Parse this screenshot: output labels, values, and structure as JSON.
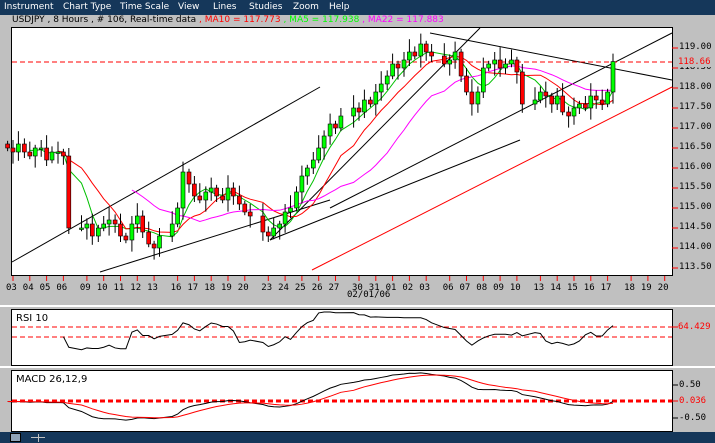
{
  "menu": [
    "Instrument",
    "Chart Type",
    "Time Scale",
    "View",
    "Lines",
    "Studies",
    "Zoom",
    "Help"
  ],
  "title": {
    "info": "USDJPY , 8 Hours , # 106, Real-time data",
    "ma10": " , MA10 = 117.773",
    "ma5": " , MA5 = 117.938",
    "ma22": " , MA22 = 117.883"
  },
  "colors": {
    "up": "#00ff00",
    "down": "#ff0000",
    "ma5": "#00c000",
    "ma10": "#ff0000",
    "ma22": "#ff00ff",
    "menubar": "#15375a"
  },
  "price_axis": [
    "119.00",
    "118.50",
    "118.00",
    "117.50",
    "117.00",
    "116.50",
    "116.00",
    "115.50",
    "115.00",
    "114.50",
    "114.00",
    "113.50"
  ],
  "current_price_label": "118.66",
  "date_ticks": [
    "03",
    "04",
    "05",
    "06",
    "09",
    "10",
    "11",
    "12",
    "13",
    "16",
    "17",
    "18",
    "19",
    "20",
    "23",
    "24",
    "25",
    "26",
    "27",
    "30",
    "31",
    "01",
    "02",
    "03",
    "06",
    "07",
    "08",
    "09",
    "10",
    "13",
    "14",
    "15",
    "16",
    "17",
    "18",
    "19",
    "20"
  ],
  "date_label": "02/01/06",
  "rsi": {
    "label": "RSI 10",
    "value": "64.429"
  },
  "macd": {
    "label": "MACD 26,12,9",
    "ticks": [
      "0.50",
      "0.036",
      "-0.50"
    ]
  },
  "chart_data": {
    "type": "candlestick",
    "instrument": "USDJPY",
    "interval": "8 Hours",
    "bars_per_day": 3,
    "ylim": [
      113.5,
      119.0
    ],
    "closes": [
      116.5,
      116.4,
      116.6,
      116.4,
      116.3,
      116.5,
      116.5,
      116.2,
      116.4,
      116.4,
      116.3,
      114.5,
      114.5,
      114.6,
      114.3,
      114.5,
      114.6,
      114.7,
      114.6,
      114.3,
      114.2,
      114.6,
      114.8,
      114.4,
      114.1,
      114.0,
      114.3,
      114.6,
      115.0,
      115.9,
      115.6,
      115.3,
      115.2,
      115.4,
      115.5,
      115.3,
      115.2,
      115.5,
      115.3,
      115.1,
      114.9,
      114.8,
      114.4,
      114.3,
      114.5,
      114.6,
      114.9,
      115.0,
      115.4,
      115.8,
      116.0,
      116.2,
      116.5,
      116.8,
      117.1,
      117.0,
      117.3,
      117.5,
      117.4,
      117.7,
      117.6,
      117.9,
      118.1,
      118.3,
      118.6,
      118.5,
      118.7,
      118.9,
      118.8,
      119.1,
      118.9,
      118.8,
      118.6,
      118.7,
      118.9,
      118.3,
      117.9,
      117.6,
      117.9,
      118.5,
      118.6,
      118.7,
      118.5,
      118.6,
      118.7,
      118.4,
      117.6,
      117.7,
      117.9,
      117.8,
      117.6,
      117.8,
      117.4,
      117.3,
      117.5,
      117.6,
      117.5,
      117.8,
      117.7,
      117.6,
      117.9,
      118.66
    ],
    "reference_line": 118.66,
    "moving_averages": [
      {
        "name": "MA5",
        "value": 117.938
      },
      {
        "name": "MA10",
        "value": 117.773
      },
      {
        "name": "MA22",
        "value": 117.883
      }
    ],
    "rsi_period": 10,
    "rsi_last": 64.429,
    "macd_params": [
      26,
      12,
      9
    ],
    "macd_last": 0.036,
    "macd_ylim": [
      -1.0,
      1.0
    ]
  }
}
